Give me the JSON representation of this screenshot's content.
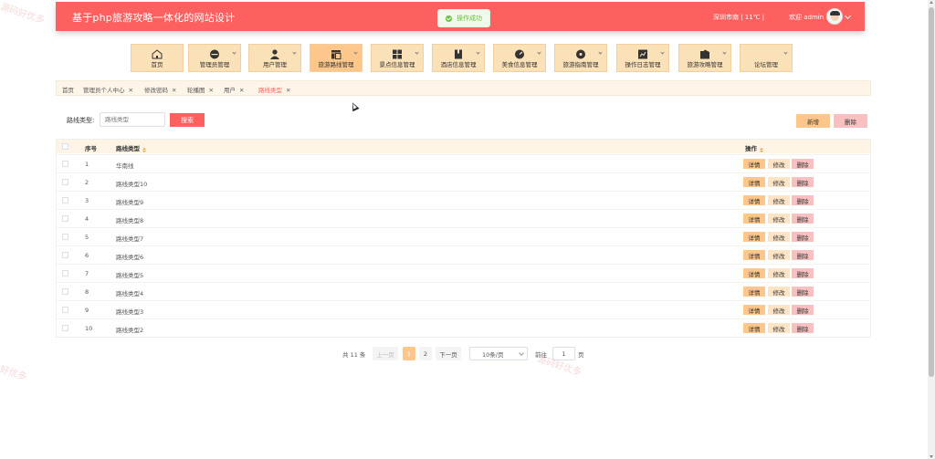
{
  "header": {
    "title": "基于php旅游攻略一体化的网站设计",
    "weather": "深圳市南 | 11℃ |",
    "welcome": "欢迎 admin",
    "bg_color": "#fe5f5f"
  },
  "toast": {
    "text": "操作成功",
    "color": "#67c23a"
  },
  "nav": {
    "items": [
      {
        "label": "首页",
        "icon": "home-icon",
        "active": false
      },
      {
        "label": "管理员管理",
        "icon": "admin-icon",
        "active": false
      },
      {
        "label": "用户管理",
        "icon": "user-icon",
        "active": false
      },
      {
        "label": "旅游路线管理",
        "icon": "route-icon",
        "active": true
      },
      {
        "label": "景点信息管理",
        "icon": "grid-icon",
        "active": false
      },
      {
        "label": "酒店信息管理",
        "icon": "book-icon",
        "active": false
      },
      {
        "label": "美食信息管理",
        "icon": "dial-icon",
        "active": false
      },
      {
        "label": "旅游指南管理",
        "icon": "disc-icon",
        "active": false
      },
      {
        "label": "操作日志管理",
        "icon": "chart-icon",
        "active": false
      },
      {
        "label": "旅游攻略管理",
        "icon": "folder-icon",
        "active": false
      },
      {
        "label": "论坛管理",
        "icon": "forum-icon",
        "active": false
      }
    ]
  },
  "tabs": [
    {
      "label": "首页",
      "closable": false
    },
    {
      "label": "管理员个人中心",
      "closable": true
    },
    {
      "label": "修改密码",
      "closable": true
    },
    {
      "label": "轮播图",
      "closable": true
    },
    {
      "label": "用户",
      "closable": true
    },
    {
      "label": "路线类型",
      "closable": true,
      "active": true
    }
  ],
  "search": {
    "label": "路线类型:",
    "placeholder": "路线类型",
    "button": "搜索"
  },
  "toolbar": {
    "add_label": "新增",
    "delete_label": "删除"
  },
  "table": {
    "columns": {
      "index": "序号",
      "type": "路线类型",
      "ops": "操作"
    },
    "actions": {
      "detail": "详情",
      "edit": "修改",
      "delete": "删除"
    },
    "rows": [
      {
        "index": "1",
        "type": "华南线"
      },
      {
        "index": "2",
        "type": "路线类型10"
      },
      {
        "index": "3",
        "type": "路线类型9"
      },
      {
        "index": "4",
        "type": "路线类型8"
      },
      {
        "index": "5",
        "type": "路线类型7"
      },
      {
        "index": "6",
        "type": "路线类型6"
      },
      {
        "index": "7",
        "type": "路线类型5"
      },
      {
        "index": "8",
        "type": "路线类型4"
      },
      {
        "index": "9",
        "type": "路线类型3"
      },
      {
        "index": "10",
        "type": "路线类型2"
      }
    ]
  },
  "pagination": {
    "total": "共 11 条",
    "prev": "上一页",
    "pages": [
      "1",
      "2"
    ],
    "current": "1",
    "next": "下一页",
    "page_size": "10条/页",
    "goto_label": "前往",
    "goto_value": "1",
    "page_unit": "页"
  },
  "watermarks": [
    "源码好优多",
    "好优多",
    "源码好优多"
  ]
}
